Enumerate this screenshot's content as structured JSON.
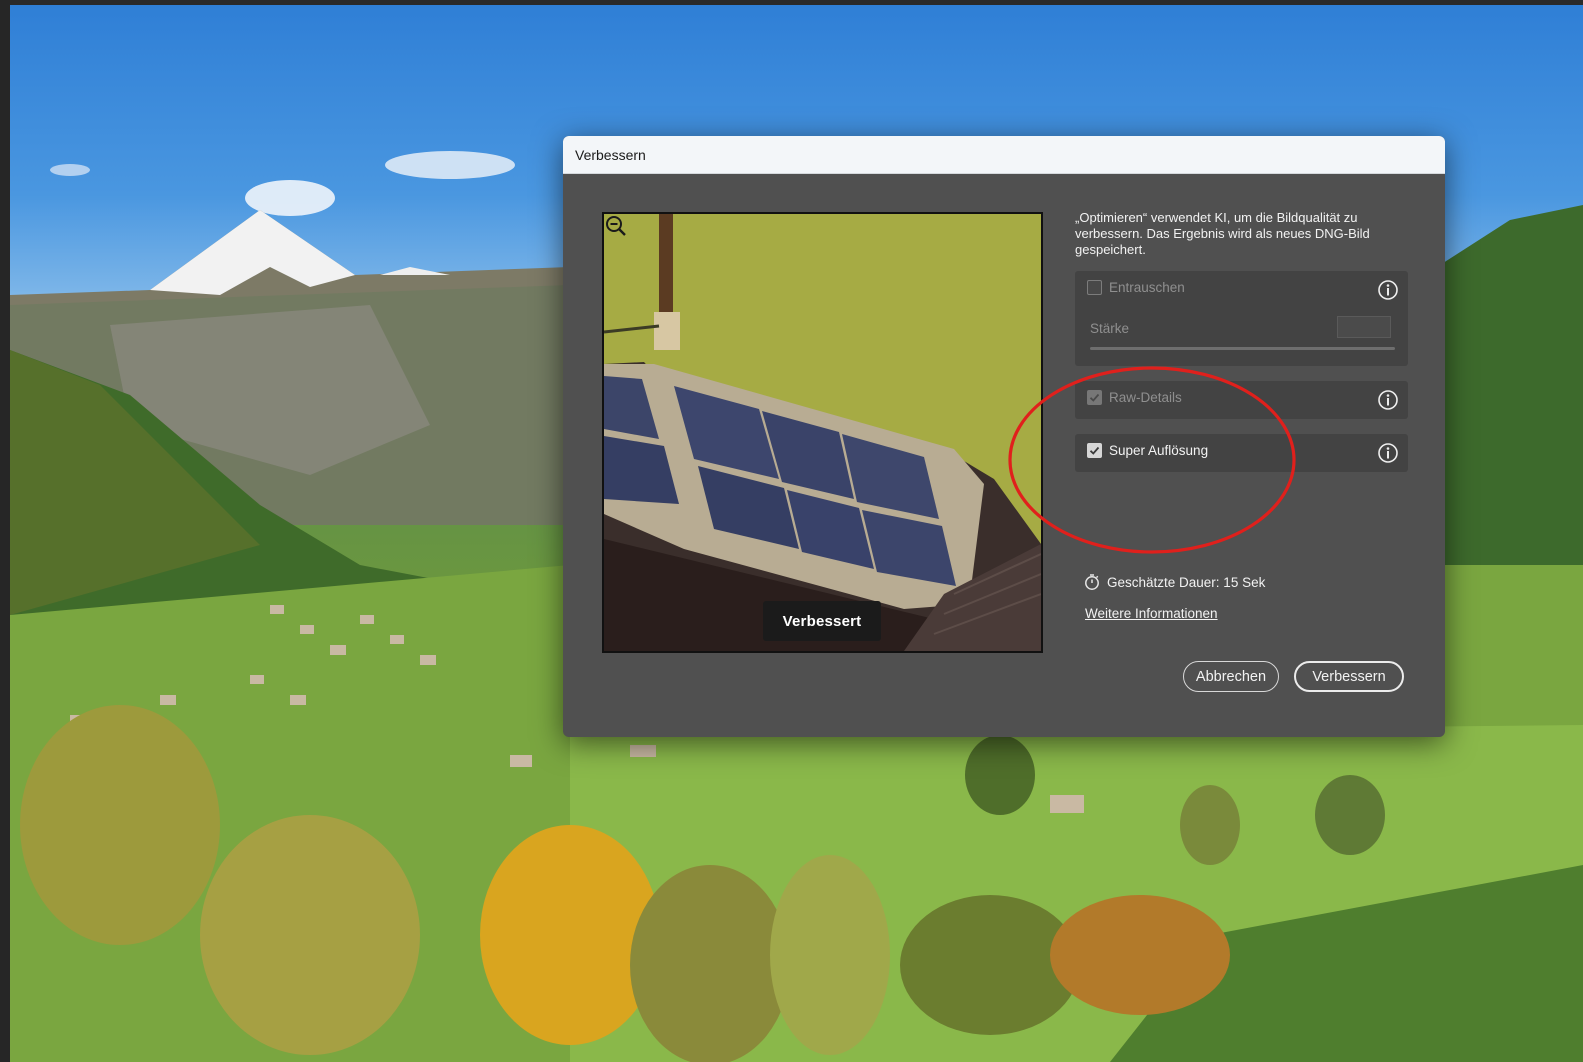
{
  "dialog": {
    "title": "Verbessern",
    "description": "„Optimieren“ verwendet KI, um die Bildqualität zu verbessern. Das Ergebnis wird als neues DNG-Bild gespeichert.",
    "preview": {
      "badge": "Verbessert",
      "zoom_icon": "zoom-out-icon"
    },
    "options": {
      "denoise": {
        "label": "Entrauschen",
        "checked": false,
        "enabled": false,
        "strength_label": "Stärke"
      },
      "raw_details": {
        "label": "Raw-Details",
        "checked": true,
        "enabled": false
      },
      "super_resolution": {
        "label": "Super Auflösung",
        "checked": true,
        "enabled": true
      }
    },
    "estimated_duration": "Geschätzte Dauer: 15 Sek",
    "more_info_link": "Weitere Informationen",
    "buttons": {
      "cancel": "Abbrechen",
      "enhance": "Verbessern"
    }
  },
  "annotation": {
    "shape": "ellipse",
    "color": "#e0201c"
  },
  "icons": {
    "info": "info-icon",
    "timer": "stopwatch-icon",
    "zoom": "zoom-out-icon"
  }
}
